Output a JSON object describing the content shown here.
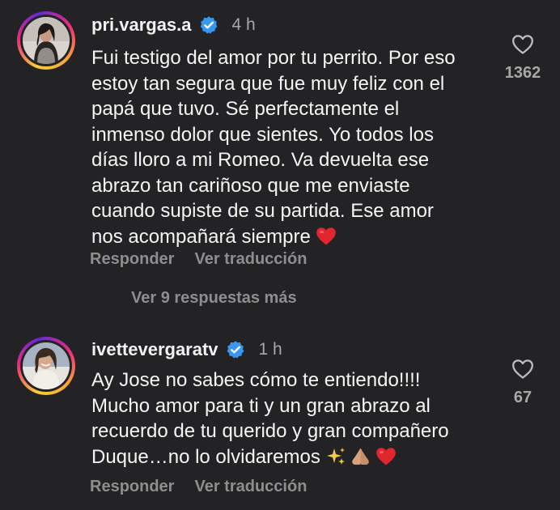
{
  "comments": [
    {
      "username": "pri.vargas.a",
      "time": "4 h",
      "text_lines": [
        "Fui testigo del amor por tu perrito. Por eso",
        "estoy tan segura que fue muy feliz con el",
        "papá que tuvo. Sé perfectamente el",
        "inmenso dolor que sientes. Yo todos los",
        "días lloro a mi Romeo. Va devuelta ese",
        "abrazo tan cariñoso que me enviaste",
        "cuando supiste de su partida. Ese amor",
        "nos acompañará siempre"
      ],
      "emoji": "❤️",
      "like_count": "1362",
      "reply_label": "Responder",
      "translate_label": "Ver traducción"
    },
    {
      "username": "ivettevergaratv",
      "time": "1 h",
      "text_lines": [
        "Ay Jose no sabes cómo te entiendo!!!!",
        "Mucho amor para ti y un gran abrazo al",
        "recuerdo de tu querido y gran compañero",
        "Duque…no lo olvidaremos"
      ],
      "emoji": "✨🙏🏼❤️",
      "like_count": "67",
      "reply_label": "Responder",
      "translate_label": "Ver traducción"
    }
  ],
  "view_more_replies": "Ver 9 respuestas más",
  "colors": {
    "background": "#232325",
    "text": "#f5f5f5",
    "muted": "#8e8e8e",
    "verified": "#3897f0",
    "heart": "#e0262f"
  }
}
